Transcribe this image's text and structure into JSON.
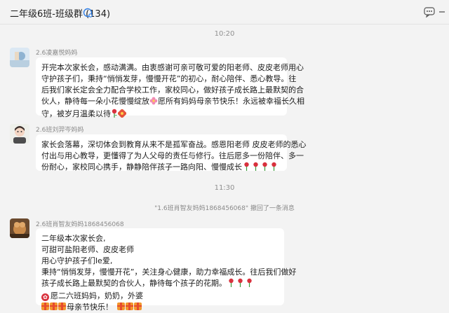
{
  "header": {
    "title": "二年级6班-班级群 (134)"
  },
  "timestamps": [
    "10:20",
    "11:30"
  ],
  "messages": [
    {
      "sender": "2.6凌嘉悦妈妈",
      "lines": [
        "开完本次家长会，感动满满。由衷感谢可亲可敬可爱的阳老师、皮皮老师用心",
        "守护孩子们，秉持“悄悄发芽，慢慢开花”的初心，耐心陪伴、悉心教导。往",
        "后我们家长定会全力配合学校工作，家校同心，做好孩子成长路上最默契的合",
        "伙人，静待每一朵小花慢慢绽放",
        "愿所有妈妈母亲节快乐！永远被幸福长久相",
        "守，被岁月温柔以待"
      ]
    },
    {
      "sender": "2.6班刘羿岑妈妈",
      "lines": [
        "家长会落幕，深切体会到教育从来不是孤军奋战。感恩阳老师 皮皮老师的悉心",
        "付出与用心教导，更懂得了为人父母的责任与修行。往后愿多一份陪伴、多一",
        "份耐心，家校同心携手，静静陪伴孩子一路向阳、慢慢成长"
      ]
    },
    {
      "sender": "2.6班肖智友妈妈1868456068",
      "lines": [
        "二年级本次家长会,",
        "可甜可盐阳老师、皮皮老师",
        "用心守护孩子们le爱,",
        "秉持“悄悄发芽，慢慢开花”，关注身心健康，助力幸福成长。往后我们做好",
        "孩子成长路上最默契的合伙人，静待每个孩子的花期。",
        "愿二六班妈妈，奶奶，外婆",
        "母亲节快乐！"
      ]
    }
  ],
  "system": {
    "recall_notice": "\"1.6班肖智友妈妈1868456068\" 撤回了一条消息"
  },
  "icons": {
    "group_icon": "group-chat-icon",
    "more_icon": "more-options-icon",
    "minimize_icon": "minimize-icon"
  },
  "colors": {
    "background": "#f3f3f3",
    "bubble": "#ffffff",
    "accent": "#2f7ee5"
  }
}
